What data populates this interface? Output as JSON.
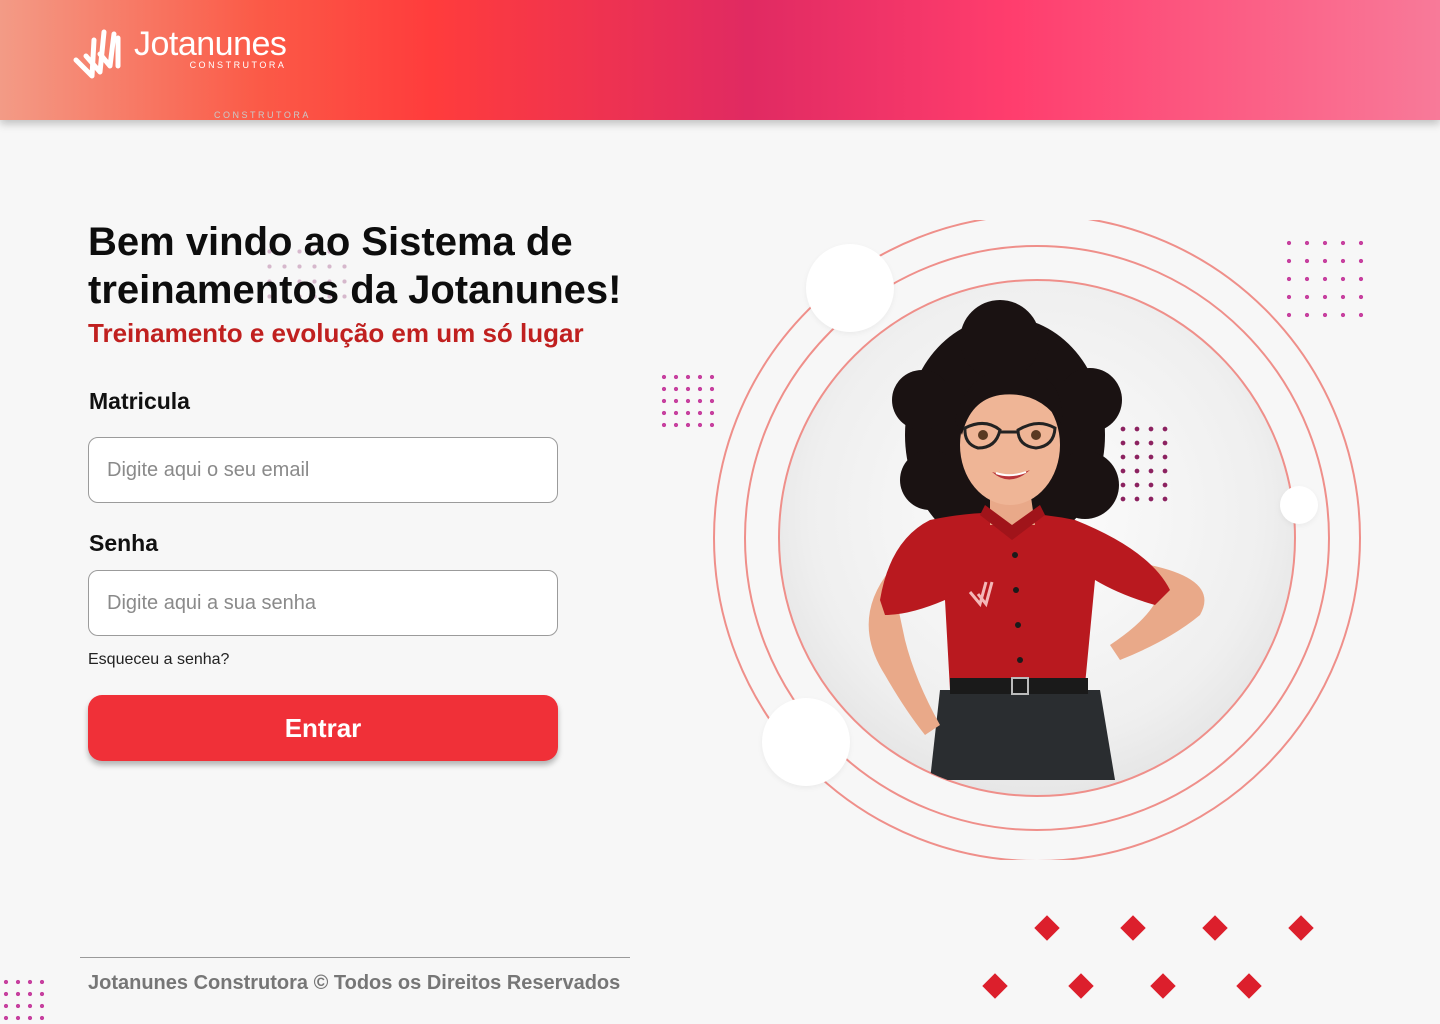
{
  "header": {
    "logo_name": "Jotanunes",
    "logo_sub": "CONSTRUTORA",
    "colors": {
      "gradient_start": "#f39b86",
      "gradient_mid": "#e02a62",
      "gradient_end": "#f87a99"
    }
  },
  "hero": {
    "title": "Bem vindo ao Sistema de treinamentos da Jotanunes!",
    "subtitle": "Treinamento e evolução em um só lugar"
  },
  "form": {
    "matricula_label": "Matricula",
    "matricula_placeholder": "Digite aqui o seu email",
    "matricula_value": "",
    "senha_label": "Senha",
    "senha_placeholder": "Digite aqui a sua senha",
    "senha_value": "",
    "forgot_link": "Esqueceu a senha?",
    "submit_label": "Entrar"
  },
  "footer": {
    "copyright": "Jotanunes Construtora © Todos os Direitos Reservados"
  },
  "theme": {
    "accent": "#f03038",
    "subtitle_color": "#c0201f",
    "dot_color": "#c7409f",
    "diamond_color": "#dc1f2c",
    "ring_color": "#ef8f8a"
  },
  "illustration": {
    "mascot_icon": "mascot-woman-illustration"
  }
}
